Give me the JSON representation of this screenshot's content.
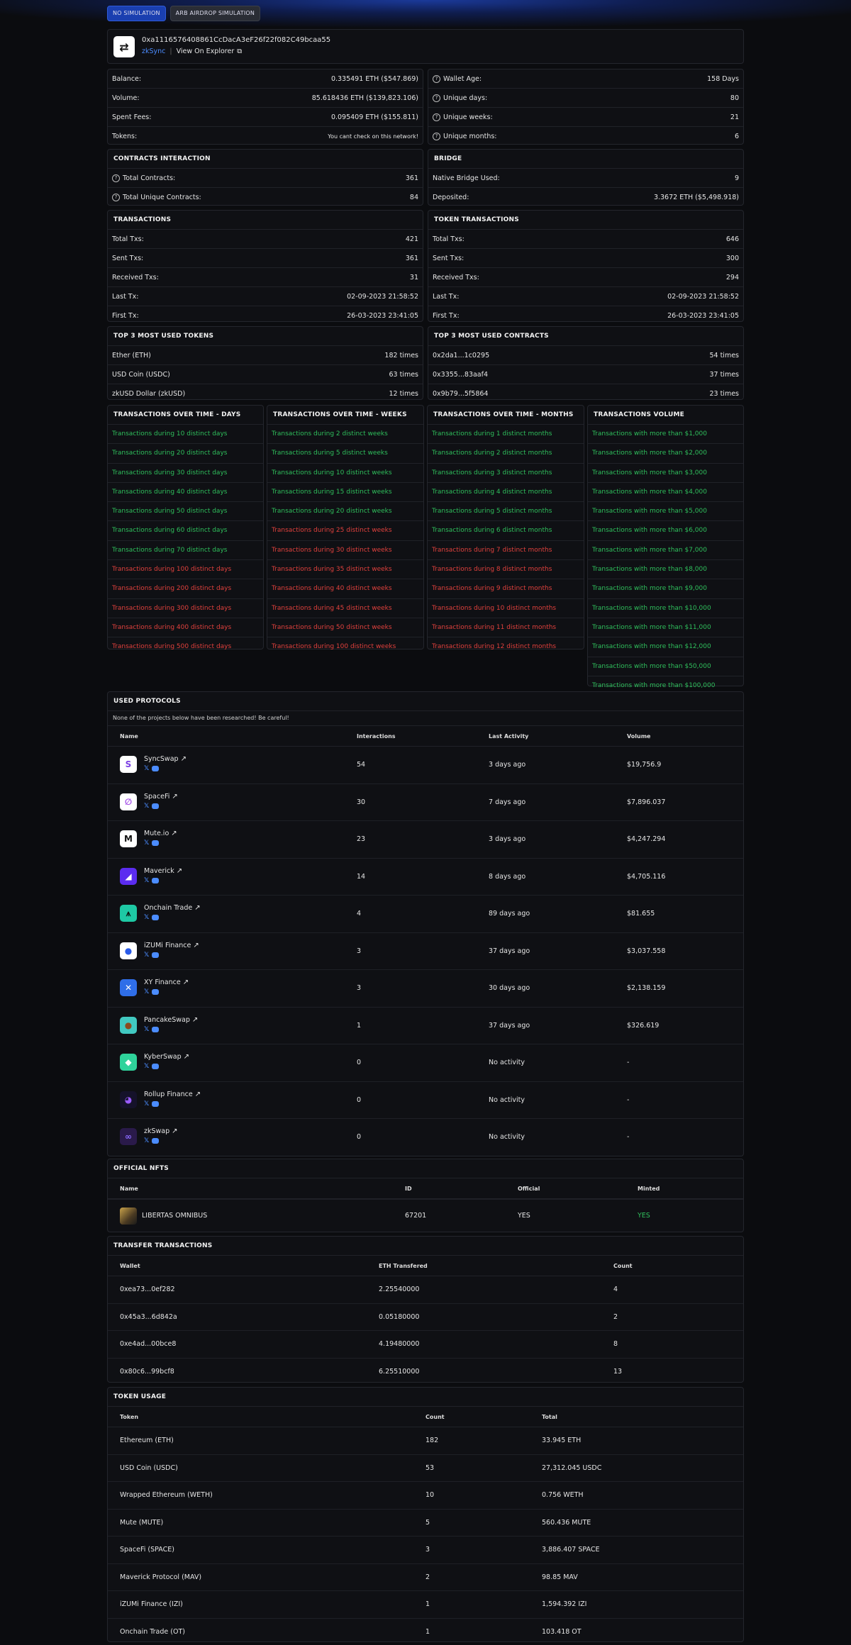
{
  "buttons": {
    "no_simulation": "NO SIMULATION",
    "arb_airdrop": "ARB AIRDROP SIMULATION"
  },
  "wallet": {
    "address": "0xa1116576408861CcDacA3eF26f22f082C49bcaa55",
    "network": "zkSync",
    "explorer": "View On Explorer"
  },
  "stats_left": [
    {
      "label": "Balance:",
      "value": "0.335491 ETH ($547.869)"
    },
    {
      "label": "Volume:",
      "value": "85.618436 ETH ($139,823.106)"
    },
    {
      "label": "Spent Fees:",
      "value": "0.095409 ETH ($155.811)"
    },
    {
      "label": "Tokens:",
      "value": "You cant check on this network!"
    }
  ],
  "stats_right": [
    {
      "label": "Wallet Age:",
      "value": "158 Days"
    },
    {
      "label": "Unique days:",
      "value": "80"
    },
    {
      "label": "Unique weeks:",
      "value": "21"
    },
    {
      "label": "Unique months:",
      "value": "6"
    }
  ],
  "contracts": {
    "title": "CONTRACTS INTERACTION",
    "rows": [
      {
        "label": "Total Contracts:",
        "value": "361"
      },
      {
        "label": "Total Unique Contracts:",
        "value": "84"
      }
    ]
  },
  "bridge": {
    "title": "BRIDGE",
    "rows": [
      {
        "label": "Native Bridge Used:",
        "value": "9"
      },
      {
        "label": "Deposited:",
        "value": "3.3672 ETH ($5,498.918)"
      }
    ]
  },
  "transactions": {
    "title": "TRANSACTIONS",
    "rows": [
      {
        "label": "Total Txs:",
        "value": "421"
      },
      {
        "label": "Sent Txs:",
        "value": "361"
      },
      {
        "label": "Received Txs:",
        "value": "31"
      },
      {
        "label": "Last Tx:",
        "value": "02-09-2023 21:58:52"
      },
      {
        "label": "First Tx:",
        "value": "26-03-2023 23:41:05"
      }
    ]
  },
  "token_transactions": {
    "title": "TOKEN TRANSACTIONS",
    "rows": [
      {
        "label": "Total Txs:",
        "value": "646"
      },
      {
        "label": "Sent Txs:",
        "value": "300"
      },
      {
        "label": "Received Txs:",
        "value": "294"
      },
      {
        "label": "Last Tx:",
        "value": "02-09-2023 21:58:52"
      },
      {
        "label": "First Tx:",
        "value": "26-03-2023 23:41:05"
      }
    ]
  },
  "top_tokens": {
    "title": "TOP 3 MOST USED TOKENS",
    "rows": [
      {
        "label": "Ether (ETH)",
        "value": "182 times"
      },
      {
        "label": "USD Coin (USDC)",
        "value": "63 times"
      },
      {
        "label": "zkUSD Dollar (zkUSD)",
        "value": "12 times"
      }
    ]
  },
  "top_contracts": {
    "title": "TOP 3 MOST USED CONTRACTS",
    "rows": [
      {
        "label": "0x2da1...1c0295",
        "value": "54 times"
      },
      {
        "label": "0x3355...83aaf4",
        "value": "37 times"
      },
      {
        "label": "0x9b79...5f5864",
        "value": "23 times"
      }
    ]
  },
  "over_time": [
    {
      "title": "TRANSACTIONS OVER TIME - DAYS",
      "items": [
        {
          "text": "Transactions during 10 distinct days",
          "ok": true
        },
        {
          "text": "Transactions during 20 distinct days",
          "ok": true
        },
        {
          "text": "Transactions during 30 distinct days",
          "ok": true
        },
        {
          "text": "Transactions during 40 distinct days",
          "ok": true
        },
        {
          "text": "Transactions during 50 distinct days",
          "ok": true
        },
        {
          "text": "Transactions during 60 distinct days",
          "ok": true
        },
        {
          "text": "Transactions during 70 distinct days",
          "ok": true
        },
        {
          "text": "Transactions during 100 distinct days",
          "ok": false
        },
        {
          "text": "Transactions during 200 distinct days",
          "ok": false
        },
        {
          "text": "Transactions during 300 distinct days",
          "ok": false
        },
        {
          "text": "Transactions during 400 distinct days",
          "ok": false
        },
        {
          "text": "Transactions during 500 distinct days",
          "ok": false
        }
      ]
    },
    {
      "title": "TRANSACTIONS OVER TIME - WEEKS",
      "items": [
        {
          "text": "Transactions during 2 distinct weeks",
          "ok": true
        },
        {
          "text": "Transactions during 5 distinct weeks",
          "ok": true
        },
        {
          "text": "Transactions during 10 distinct weeks",
          "ok": true
        },
        {
          "text": "Transactions during 15 distinct weeks",
          "ok": true
        },
        {
          "text": "Transactions during 20 distinct weeks",
          "ok": true
        },
        {
          "text": "Transactions during 25 distinct weeks",
          "ok": false
        },
        {
          "text": "Transactions during 30 distinct weeks",
          "ok": false
        },
        {
          "text": "Transactions during 35 distinct weeks",
          "ok": false
        },
        {
          "text": "Transactions during 40 distinct weeks",
          "ok": false
        },
        {
          "text": "Transactions during 45 distinct weeks",
          "ok": false
        },
        {
          "text": "Transactions during 50 distinct weeks",
          "ok": false
        },
        {
          "text": "Transactions during 100 distinct weeks",
          "ok": false
        }
      ]
    },
    {
      "title": "TRANSACTIONS OVER TIME - MONTHS",
      "items": [
        {
          "text": "Transactions during 1 distinct months",
          "ok": true
        },
        {
          "text": "Transactions during 2 distinct months",
          "ok": true
        },
        {
          "text": "Transactions during 3 distinct months",
          "ok": true
        },
        {
          "text": "Transactions during 4 distinct months",
          "ok": true
        },
        {
          "text": "Transactions during 5 distinct months",
          "ok": true
        },
        {
          "text": "Transactions during 6 distinct months",
          "ok": true
        },
        {
          "text": "Transactions during 7 distinct months",
          "ok": false
        },
        {
          "text": "Transactions during 8 distinct months",
          "ok": false
        },
        {
          "text": "Transactions during 9 distinct months",
          "ok": false
        },
        {
          "text": "Transactions during 10 distinct months",
          "ok": false
        },
        {
          "text": "Transactions during 11 distinct months",
          "ok": false
        },
        {
          "text": "Transactions during 12 distinct months",
          "ok": false
        }
      ]
    },
    {
      "title": "TRANSACTIONS VOLUME",
      "items": [
        {
          "text": "Transactions with more than $1,000",
          "ok": true
        },
        {
          "text": "Transactions with more than $2,000",
          "ok": true
        },
        {
          "text": "Transactions with more than $3,000",
          "ok": true
        },
        {
          "text": "Transactions with more than $4,000",
          "ok": true
        },
        {
          "text": "Transactions with more than $5,000",
          "ok": true
        },
        {
          "text": "Transactions with more than $6,000",
          "ok": true
        },
        {
          "text": "Transactions with more than $7,000",
          "ok": true
        },
        {
          "text": "Transactions with more than $8,000",
          "ok": true
        },
        {
          "text": "Transactions with more than $9,000",
          "ok": true
        },
        {
          "text": "Transactions with more than $10,000",
          "ok": true
        },
        {
          "text": "Transactions with more than $11,000",
          "ok": true
        },
        {
          "text": "Transactions with more than $12,000",
          "ok": true
        },
        {
          "text": "Transactions with more than $50,000",
          "ok": true
        },
        {
          "text": "Transactions with more than $100,000",
          "ok": true
        }
      ]
    }
  ],
  "protocols": {
    "title": "USED PROTOCOLS",
    "warning": "None of the projects below have been researched! Be careful!",
    "headers": [
      "Name",
      "Interactions",
      "Last Activity",
      "Volume"
    ],
    "rows": [
      {
        "name": "SyncSwap",
        "interactions": "54",
        "last": "3 days ago",
        "volume": "$19,756.9",
        "logo_bg": "#ffffff",
        "logo_fg": "#7b3fe4",
        "glyph": "S"
      },
      {
        "name": "SpaceFi",
        "interactions": "30",
        "last": "7 days ago",
        "volume": "$7,896.037",
        "logo_bg": "#ffffff",
        "logo_fg": "#a34be8",
        "glyph": "∅"
      },
      {
        "name": "Mute.io",
        "interactions": "23",
        "last": "3 days ago",
        "volume": "$4,247.294",
        "logo_bg": "#ffffff",
        "logo_fg": "#111111",
        "glyph": "M"
      },
      {
        "name": "Maverick",
        "interactions": "14",
        "last": "8 days ago",
        "volume": "$4,705.116",
        "logo_bg": "#5b2cf0",
        "logo_fg": "#ffffff",
        "glyph": "◢"
      },
      {
        "name": "Onchain Trade",
        "interactions": "4",
        "last": "89 days ago",
        "volume": "$81.655",
        "logo_bg": "#1ec9a4",
        "logo_fg": "#0b1a14",
        "glyph": "⩚"
      },
      {
        "name": "iZUMi Finance",
        "interactions": "3",
        "last": "37 days ago",
        "volume": "$3,037.558",
        "logo_bg": "#ffffff",
        "logo_fg": "#2a5be8",
        "glyph": "●"
      },
      {
        "name": "XY Finance",
        "interactions": "3",
        "last": "30 days ago",
        "volume": "$2,138.159",
        "logo_bg": "#2f6ee8",
        "logo_fg": "#ffffff",
        "glyph": "✕"
      },
      {
        "name": "PancakeSwap",
        "interactions": "1",
        "last": "37 days ago",
        "volume": "$326.619",
        "logo_bg": "#41c9c1",
        "logo_fg": "#8a4b1f",
        "glyph": "●"
      },
      {
        "name": "KyberSwap",
        "interactions": "0",
        "last": "No activity",
        "volume": "-",
        "logo_bg": "#2fd39b",
        "logo_fg": "#ffffff",
        "glyph": "◆"
      },
      {
        "name": "Rollup Finance",
        "interactions": "0",
        "last": "No activity",
        "volume": "-",
        "logo_bg": "#15122a",
        "logo_fg": "#9a5bff",
        "glyph": "◕"
      },
      {
        "name": "zkSwap",
        "interactions": "0",
        "last": "No activity",
        "volume": "-",
        "logo_bg": "#2a1a4a",
        "logo_fg": "#8b6bff",
        "glyph": "∞"
      }
    ]
  },
  "nfts": {
    "title": "OFFICIAL NFTS",
    "headers": [
      "Name",
      "ID",
      "Official",
      "Minted"
    ],
    "rows": [
      {
        "name": "LIBERTAS OMNIBUS",
        "id": "67201",
        "official": "YES",
        "minted": "YES"
      }
    ]
  },
  "transfers": {
    "title": "TRANSFER TRANSACTIONS",
    "headers": [
      "Wallet",
      "ETH Transfered",
      "Count"
    ],
    "rows": [
      {
        "wallet": "0xea73...0ef282",
        "eth": "2.25540000",
        "count": "4"
      },
      {
        "wallet": "0x45a3...6d842a",
        "eth": "0.05180000",
        "count": "2"
      },
      {
        "wallet": "0xe4ad...00bce8",
        "eth": "4.19480000",
        "count": "8"
      },
      {
        "wallet": "0x80c6...99bcf8",
        "eth": "6.25510000",
        "count": "13"
      }
    ]
  },
  "token_usage": {
    "title": "TOKEN USAGE",
    "headers": [
      "Token",
      "Count",
      "Total"
    ],
    "rows": [
      {
        "token": "Ethereum (ETH)",
        "count": "182",
        "total": "33.945 ETH"
      },
      {
        "token": "USD Coin (USDC)",
        "count": "53",
        "total": "27,312.045 USDC"
      },
      {
        "token": "Wrapped Ethereum (WETH)",
        "count": "10",
        "total": "0.756 WETH"
      },
      {
        "token": "Mute (MUTE)",
        "count": "5",
        "total": "560.436 MUTE"
      },
      {
        "token": "SpaceFi (SPACE)",
        "count": "3",
        "total": "3,886.407 SPACE"
      },
      {
        "token": "Maverick Protocol (MAV)",
        "count": "2",
        "total": "98.85 MAV"
      },
      {
        "token": "iZUMi Finance (IZI)",
        "count": "1",
        "total": "1,594.392 IZI"
      },
      {
        "token": "Onchain Trade (OT)",
        "count": "1",
        "total": "103.418 OT"
      }
    ]
  },
  "colors": {
    "accent": "#1a3fb0",
    "green": "#2fbf5c",
    "red": "#e0413d",
    "link": "#4b8cff"
  }
}
